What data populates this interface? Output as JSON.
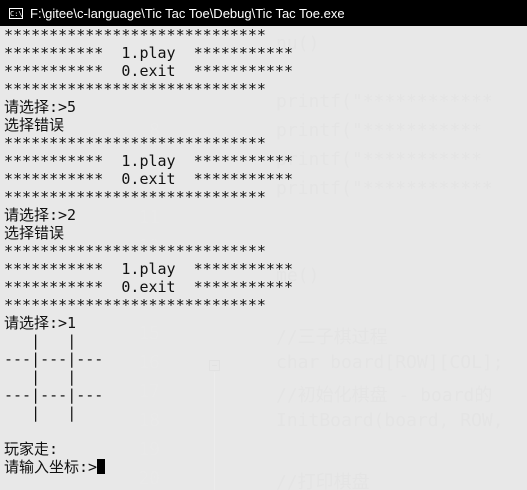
{
  "window": {
    "title": "F:\\gitee\\c-language\\Tic Tac Toe\\Debug\\Tic Tac Toe.exe",
    "icon": "console-app-icon",
    "icon_text": "C:\\"
  },
  "console_lines": [
    "*****************************",
    "***********  1.play  ***********",
    "***********  0.exit  ***********",
    "*****************************",
    "请选择:>5",
    "选择错误",
    "*****************************",
    "***********  1.play  ***********",
    "***********  0.exit  ***********",
    "*****************************",
    "请选择:>2",
    "选择错误",
    "*****************************",
    "***********  1.play  ***********",
    "***********  0.exit  ***********",
    "*****************************",
    "请选择:>1",
    "   |   |",
    "---|---|---",
    "   |   |",
    "---|---|---",
    "   |   |",
    "",
    "玩家走:",
    "请输入坐标:>"
  ],
  "background_editor": [
    {
      "num": "",
      "code": "nu()"
    },
    {
      "num": "",
      "code": ""
    },
    {
      "num": "",
      "code": "printf(\"************"
    },
    {
      "num": "8",
      "code": "printf(\"***********"
    },
    {
      "num": "",
      "code": "printf(\"***********"
    },
    {
      "num": "",
      "code": "printf(\"************"
    },
    {
      "num": "11",
      "code": ""
    },
    {
      "num": "12",
      "code": ""
    },
    {
      "num": "",
      "code": "me()"
    },
    {
      "num": "14",
      "code": ""
    },
    {
      "num": "15",
      "code": "//三子棋过程"
    },
    {
      "num": "16",
      "code": "char board[ROW][COL];"
    },
    {
      "num": "17",
      "code": "//初始化棋盘 - board的"
    },
    {
      "num": "18",
      "code": "InitBoard(board, ROW,"
    },
    {
      "num": "19",
      "code": ""
    },
    {
      "num": "20",
      "code": "//打印棋盘"
    }
  ]
}
